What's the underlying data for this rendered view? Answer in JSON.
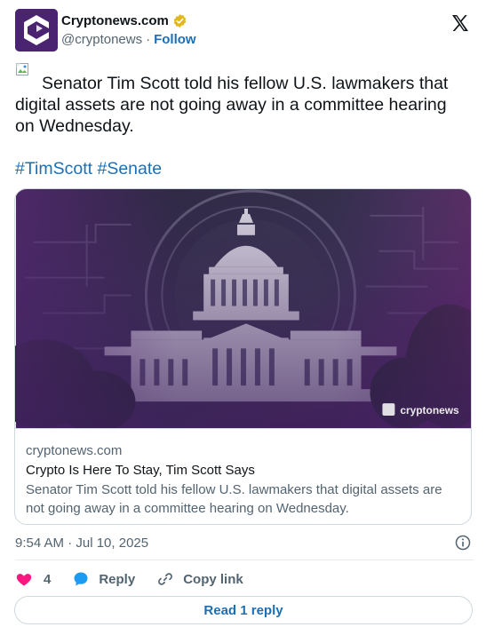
{
  "author": {
    "name": "Cryptonews.com",
    "handle": "@cryptonews",
    "separator": "·",
    "follow_label": "Follow"
  },
  "tweet": {
    "text": "Senator Tim Scott told his fellow U.S. lawmakers that digital assets are not going away in a committee hearing on Wednesday.",
    "hashtags": [
      "#TimScott",
      "#Senate"
    ]
  },
  "card": {
    "image_watermark": "cryptonews",
    "domain": "cryptonews.com",
    "title": "Crypto Is Here To Stay, Tim Scott Says",
    "description": "Senator Tim Scott told his fellow U.S. lawmakers that digital assets are not going away in a committee hearing on Wednesday."
  },
  "meta": {
    "timestamp": "9:54 AM · Jul 10, 2025"
  },
  "actions": {
    "like_count": "4",
    "reply_label": "Reply",
    "copy_link_label": "Copy link"
  },
  "read_reply_label": "Read 1 reply",
  "colors": {
    "link": "#1d6fb5",
    "like": "#f91880",
    "reply_bubble": "#1d9bf0",
    "secondary_text": "#536471",
    "brand_purple": "#4a2470"
  },
  "icons": {
    "verified": "verified-badge-icon",
    "x": "x-logo-icon",
    "info": "info-icon",
    "like": "heart-icon",
    "reply": "chat-bubble-icon",
    "copy_link": "link-icon"
  }
}
